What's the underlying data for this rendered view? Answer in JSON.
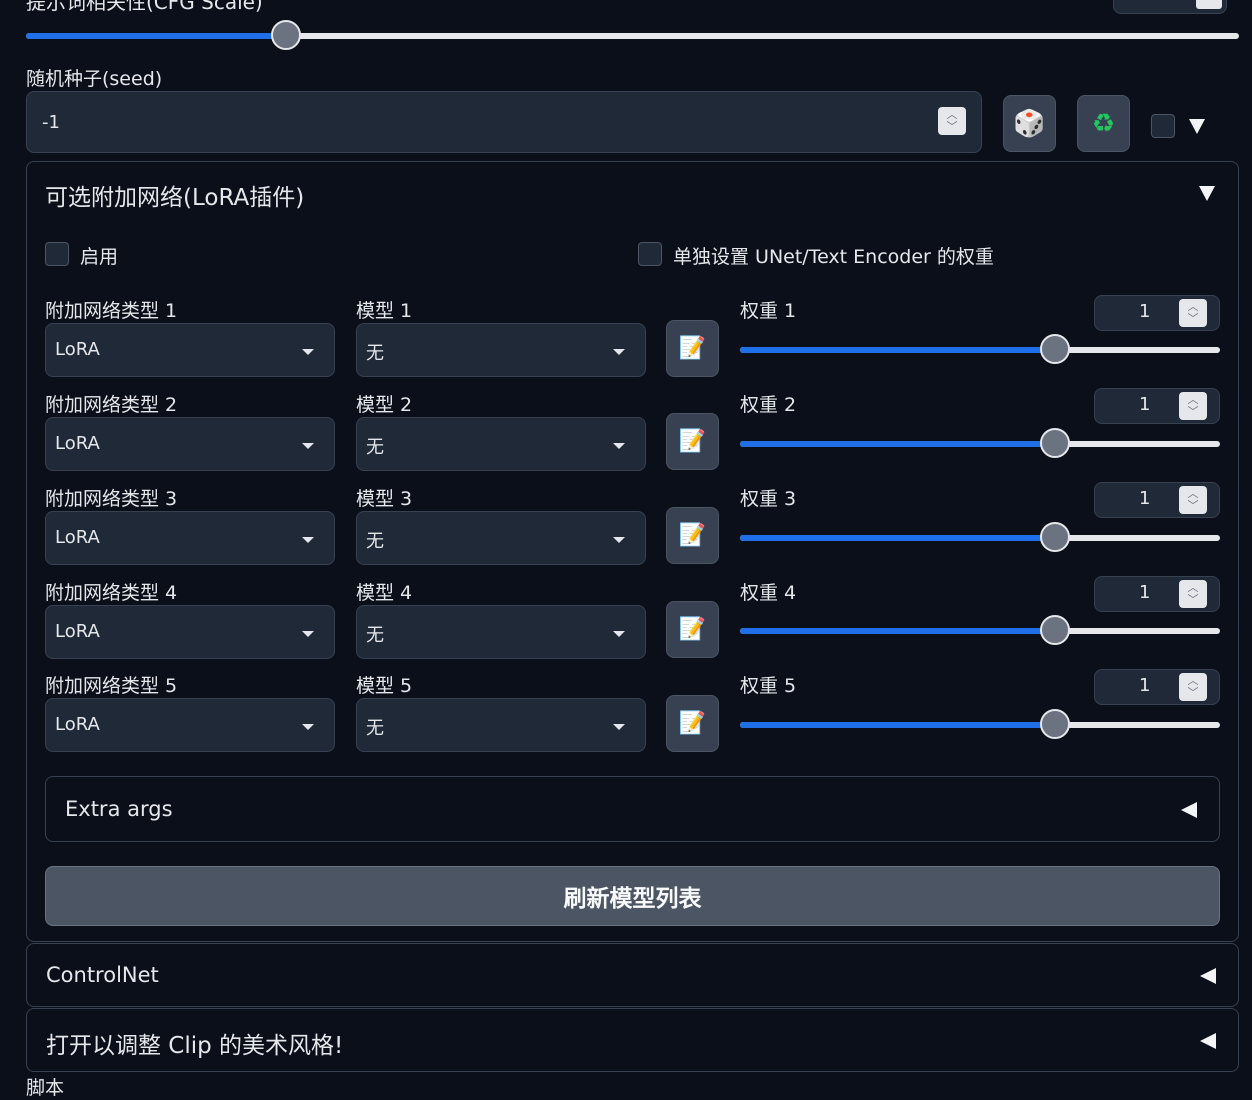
{
  "cfg": {
    "label": "提示词相关性(CFG Scale)",
    "value": "7",
    "fraction": 0.214
  },
  "seed": {
    "label": "随机种子(seed)",
    "value": "-1",
    "dice_icon": "dice-icon",
    "recycle_icon": "recycle-icon"
  },
  "lora": {
    "title": "可选附加网络(LoRA插件)",
    "enable_label": "启用",
    "separate_weight_label": "单独设置 UNet/Text Encoder 的权重",
    "rows": [
      {
        "type_label": "附加网络类型 1",
        "type_value": "LoRA",
        "model_label": "模型 1",
        "model_value": "无",
        "weight_label": "权重 1",
        "weight_value": "1",
        "weight_fraction": 0.656
      },
      {
        "type_label": "附加网络类型 2",
        "type_value": "LoRA",
        "model_label": "模型 2",
        "model_value": "无",
        "weight_label": "权重 2",
        "weight_value": "1",
        "weight_fraction": 0.656
      },
      {
        "type_label": "附加网络类型 3",
        "type_value": "LoRA",
        "model_label": "模型 3",
        "model_value": "无",
        "weight_label": "权重 3",
        "weight_value": "1",
        "weight_fraction": 0.656
      },
      {
        "type_label": "附加网络类型 4",
        "type_value": "LoRA",
        "model_label": "模型 4",
        "model_value": "无",
        "weight_label": "权重 4",
        "weight_value": "1",
        "weight_fraction": 0.656
      },
      {
        "type_label": "附加网络类型 5",
        "type_value": "LoRA",
        "model_label": "模型 5",
        "model_value": "无",
        "weight_label": "权重 5",
        "weight_value": "1",
        "weight_fraction": 0.656
      }
    ],
    "extra_args_label": "Extra args",
    "refresh_label": "刷新模型列表"
  },
  "controlnet": {
    "label": "ControlNet"
  },
  "clip_style": {
    "label": "打开以调整 Clip 的美术风格!"
  },
  "script_label": "脚本",
  "colors": {
    "accent": "#1f6fe8",
    "background": "#0b0f19",
    "input_bg": "#1f2937"
  }
}
